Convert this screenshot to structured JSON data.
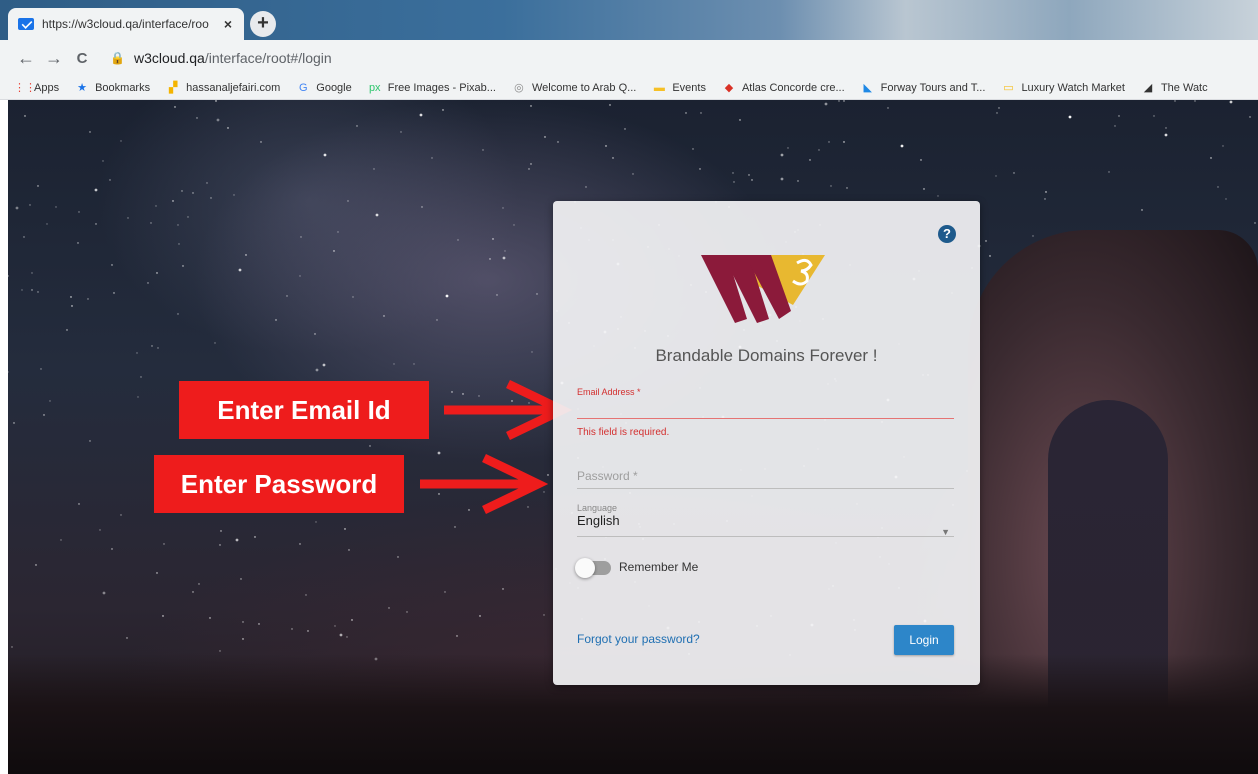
{
  "browser": {
    "tab_title": "https://w3cloud.qa/interface/roo",
    "tab_close": "×",
    "new_tab": "+",
    "back": "←",
    "forward": "→",
    "reload": "C",
    "url_host": "w3cloud.qa",
    "url_path": "/interface/root#/login",
    "bookmarks": [
      {
        "label": "Apps",
        "icon": "apps-grid-icon",
        "color": "#e94235"
      },
      {
        "label": "Bookmarks",
        "icon": "star-icon",
        "color": "#1a73e8"
      },
      {
        "label": "hassanaljefairi.com",
        "icon": "chart-favicon-icon",
        "color": "#f4b400"
      },
      {
        "label": "Google",
        "icon": "google-icon",
        "color": "#4285f4"
      },
      {
        "label": "Free Images - Pixab...",
        "icon": "pixabay-icon",
        "color": "#2ec66d"
      },
      {
        "label": "Welcome to Arab Q...",
        "icon": "globe-icon",
        "color": "#8a8a8a"
      },
      {
        "label": "Events",
        "icon": "folder-icon",
        "color": "#f6c026"
      },
      {
        "label": "Atlas Concorde cre...",
        "icon": "diamond-icon",
        "color": "#d93025"
      },
      {
        "label": "Forway Tours and T...",
        "icon": "plane-icon",
        "color": "#1e88e5"
      },
      {
        "label": "Luxury Watch Market",
        "icon": "watch-icon",
        "color": "#f6c026"
      },
      {
        "label": "The Watc",
        "icon": "watch-chart-icon",
        "color": "#333333"
      }
    ]
  },
  "annotations": {
    "email_callout": "Enter Email Id",
    "password_callout": "Enter Password",
    "arrow_color": "#ee1c1c"
  },
  "login": {
    "help": "?",
    "tagline": "Brandable Domains Forever !",
    "email_label": "Email Address *",
    "email_error": "This field is required.",
    "password_placeholder": "Password *",
    "language_label": "Language",
    "language_value": "English",
    "remember_label": "Remember Me",
    "forgot_link": "Forgot your password?",
    "login_button": "Login",
    "colors": {
      "primary": "#2d86c9",
      "error": "#d32f2f",
      "logo_maroon": "#8b1a3a",
      "logo_gold": "#e8b830"
    }
  }
}
